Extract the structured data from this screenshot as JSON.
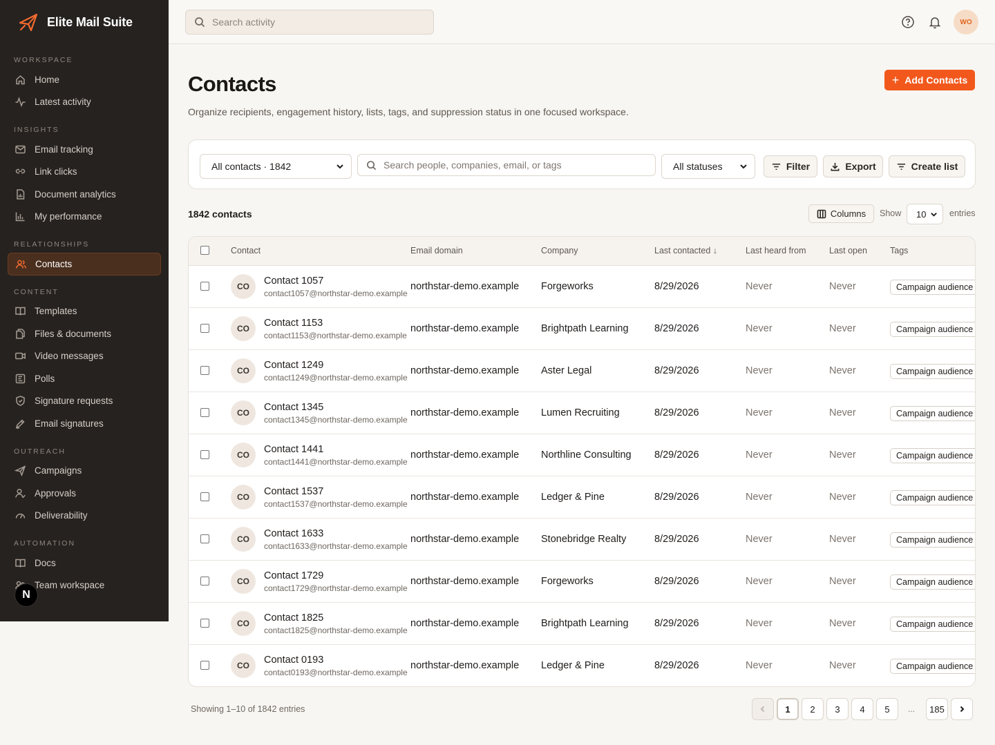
{
  "app": {
    "name": "Elite Mail Suite"
  },
  "sidebar": {
    "sections": [
      {
        "heading": "WORKSPACE",
        "items": [
          {
            "label": "Home",
            "icon": "home-icon"
          },
          {
            "label": "Latest activity",
            "icon": "activity-icon"
          }
        ]
      },
      {
        "heading": "INSIGHTS",
        "items": [
          {
            "label": "Email tracking",
            "icon": "mail-icon"
          },
          {
            "label": "Link clicks",
            "icon": "link-icon"
          },
          {
            "label": "Document analytics",
            "icon": "doc-chart-icon"
          },
          {
            "label": "My performance",
            "icon": "bar-chart-icon"
          }
        ]
      },
      {
        "heading": "RELATIONSHIPS",
        "items": [
          {
            "label": "Contacts",
            "icon": "users-icon",
            "active": true
          }
        ]
      },
      {
        "heading": "CONTENT",
        "items": [
          {
            "label": "Templates",
            "icon": "book-icon"
          },
          {
            "label": "Files & documents",
            "icon": "files-icon"
          },
          {
            "label": "Video messages",
            "icon": "video-icon"
          },
          {
            "label": "Polls",
            "icon": "poll-icon"
          },
          {
            "label": "Signature requests",
            "icon": "shield-icon"
          },
          {
            "label": "Email signatures",
            "icon": "pen-icon"
          }
        ]
      },
      {
        "heading": "OUTREACH",
        "items": [
          {
            "label": "Campaigns",
            "icon": "send-icon"
          },
          {
            "label": "Approvals",
            "icon": "user-check-icon"
          },
          {
            "label": "Deliverability",
            "icon": "gauge-icon"
          }
        ]
      },
      {
        "heading": "AUTOMATION",
        "items": [
          {
            "label": "Docs",
            "icon": "book-open-icon"
          },
          {
            "label": "Team workspace",
            "icon": "team-icon"
          }
        ]
      }
    ],
    "badge": "N"
  },
  "topbar": {
    "search_placeholder": "Search activity",
    "avatar_initials": "WO"
  },
  "page": {
    "title": "Contacts",
    "subtitle": "Organize recipients, engagement history, lists, tags, and suppression status in one focused workspace.",
    "add_button": "Add Contacts"
  },
  "filters": {
    "list_select": "All contacts · 1842",
    "search_placeholder": "Search people, companies, email, or tags",
    "status_select": "All statuses",
    "filter_btn": "Filter",
    "export_btn": "Export",
    "create_list_btn": "Create list"
  },
  "table_meta": {
    "count_label": "1842 contacts",
    "columns_btn": "Columns",
    "show_label": "Show",
    "page_size": "10",
    "entries_label": "entries"
  },
  "columns": {
    "contact": "Contact",
    "domain": "Email domain",
    "company": "Company",
    "last_contacted": "Last contacted ↓",
    "last_heard": "Last heard from",
    "last_open": "Last open",
    "tags": "Tags"
  },
  "rows": [
    {
      "initials": "CO",
      "name": "Contact 1057",
      "email": "contact1057@northstar-demo.example",
      "domain": "northstar-demo.example",
      "company": "Forgeworks",
      "last_contacted": "8/29/2026",
      "last_heard": "Never",
      "last_open": "Never",
      "tag": "Campaign audience"
    },
    {
      "initials": "CO",
      "name": "Contact 1153",
      "email": "contact1153@northstar-demo.example",
      "domain": "northstar-demo.example",
      "company": "Brightpath Learning",
      "last_contacted": "8/29/2026",
      "last_heard": "Never",
      "last_open": "Never",
      "tag": "Campaign audience"
    },
    {
      "initials": "CO",
      "name": "Contact 1249",
      "email": "contact1249@northstar-demo.example",
      "domain": "northstar-demo.example",
      "company": "Aster Legal",
      "last_contacted": "8/29/2026",
      "last_heard": "Never",
      "last_open": "Never",
      "tag": "Campaign audience"
    },
    {
      "initials": "CO",
      "name": "Contact 1345",
      "email": "contact1345@northstar-demo.example",
      "domain": "northstar-demo.example",
      "company": "Lumen Recruiting",
      "last_contacted": "8/29/2026",
      "last_heard": "Never",
      "last_open": "Never",
      "tag": "Campaign audience"
    },
    {
      "initials": "CO",
      "name": "Contact 1441",
      "email": "contact1441@northstar-demo.example",
      "domain": "northstar-demo.example",
      "company": "Northline Consulting",
      "last_contacted": "8/29/2026",
      "last_heard": "Never",
      "last_open": "Never",
      "tag": "Campaign audience"
    },
    {
      "initials": "CO",
      "name": "Contact 1537",
      "email": "contact1537@northstar-demo.example",
      "domain": "northstar-demo.example",
      "company": "Ledger & Pine",
      "last_contacted": "8/29/2026",
      "last_heard": "Never",
      "last_open": "Never",
      "tag": "Campaign audience"
    },
    {
      "initials": "CO",
      "name": "Contact 1633",
      "email": "contact1633@northstar-demo.example",
      "domain": "northstar-demo.example",
      "company": "Stonebridge Realty",
      "last_contacted": "8/29/2026",
      "last_heard": "Never",
      "last_open": "Never",
      "tag": "Campaign audience"
    },
    {
      "initials": "CO",
      "name": "Contact 1729",
      "email": "contact1729@northstar-demo.example",
      "domain": "northstar-demo.example",
      "company": "Forgeworks",
      "last_contacted": "8/29/2026",
      "last_heard": "Never",
      "last_open": "Never",
      "tag": "Campaign audience"
    },
    {
      "initials": "CO",
      "name": "Contact 1825",
      "email": "contact1825@northstar-demo.example",
      "domain": "northstar-demo.example",
      "company": "Brightpath Learning",
      "last_contacted": "8/29/2026",
      "last_heard": "Never",
      "last_open": "Never",
      "tag": "Campaign audience"
    },
    {
      "initials": "CO",
      "name": "Contact 0193",
      "email": "contact0193@northstar-demo.example",
      "domain": "northstar-demo.example",
      "company": "Ledger & Pine",
      "last_contacted": "8/29/2026",
      "last_heard": "Never",
      "last_open": "Never",
      "tag": "Campaign audience"
    }
  ],
  "pagination": {
    "summary": "Showing 1–10 of 1842 entries",
    "pages": [
      "1",
      "2",
      "3",
      "4",
      "5"
    ],
    "current": "1",
    "ellipsis": "...",
    "last": "185"
  },
  "colors": {
    "accent": "#f2581c",
    "sidebar_bg": "#26221f",
    "active_nav_bg": "#4a2f1f"
  }
}
